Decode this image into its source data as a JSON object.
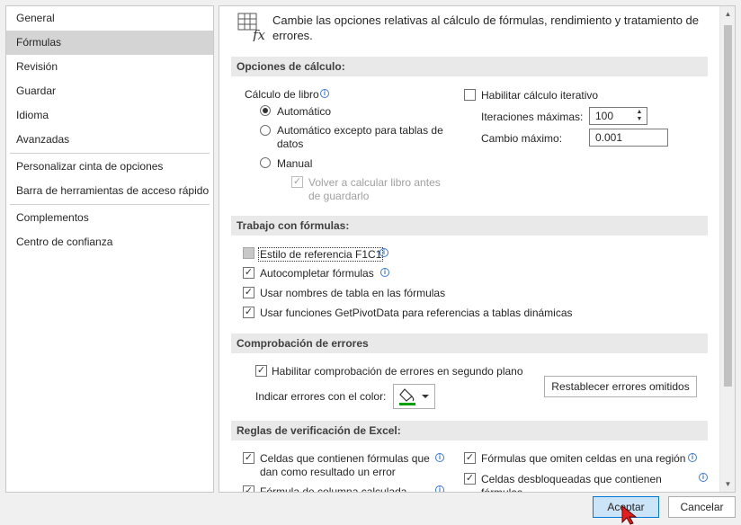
{
  "sidebar": {
    "groups": [
      [
        "General",
        "Fórmulas",
        "Revisión",
        "Guardar",
        "Idioma",
        "Avanzadas"
      ],
      [
        "Personalizar cinta de opciones",
        "Barra de herramientas de acceso rápido"
      ],
      [
        "Complementos",
        "Centro de confianza"
      ]
    ],
    "selected": "Fórmulas"
  },
  "header": {
    "icon": "formula-fx-icon",
    "text": "Cambie las opciones relativas al cálculo de fórmulas, rendimiento y tratamiento de errores."
  },
  "calc": {
    "title": "Opciones de cálculo:",
    "workbook_label": "Cálculo de libro",
    "opt_auto": "Automático",
    "opt_auto_except": "Automático excepto para tablas de datos",
    "opt_manual": "Manual",
    "recalc_before_save": "Volver a calcular libro antes de guardarlo",
    "selected_mode": "Automático",
    "recalc_checked": true,
    "recalc_enabled": false,
    "iterative_label": "Habilitar cálculo iterativo",
    "iterative_checked": false,
    "max_iter_label": "Iteraciones máximas:",
    "max_iter_value": "100",
    "max_change_label": "Cambio máximo:",
    "max_change_value": "0.001"
  },
  "formulas": {
    "title": "Trabajo con fórmulas:",
    "r1c1_label": "Estilo de referencia F1C1",
    "r1c1_checked": false,
    "autocomplete_label": "Autocompletar fórmulas",
    "autocomplete_checked": true,
    "table_names_label": "Usar nombres de tabla en las fórmulas",
    "table_names_checked": true,
    "getpivot_label": "Usar funciones GetPivotData para referencias a tablas dinámicas",
    "getpivot_checked": true
  },
  "errors": {
    "title": "Comprobación de errores",
    "background_label": "Habilitar comprobación de errores en segundo plano",
    "background_checked": true,
    "color_label": "Indicar errores con el color:",
    "color_value": "#00a000",
    "reset_button": "Restablecer errores omitidos"
  },
  "rules": {
    "title": "Reglas de verificación de Excel:",
    "left": [
      {
        "label": "Celdas que contienen fórmulas que dan como resultado un error",
        "checked": true
      },
      {
        "label": "Fórmula de columna calculada",
        "checked": true
      }
    ],
    "right": [
      {
        "label": "Fórmulas que omiten celdas en una región",
        "checked": true
      },
      {
        "label": "Celdas desbloqueadas que contienen fórmulas",
        "checked": true
      }
    ]
  },
  "footer": {
    "ok": "Aceptar",
    "cancel": "Cancelar"
  }
}
